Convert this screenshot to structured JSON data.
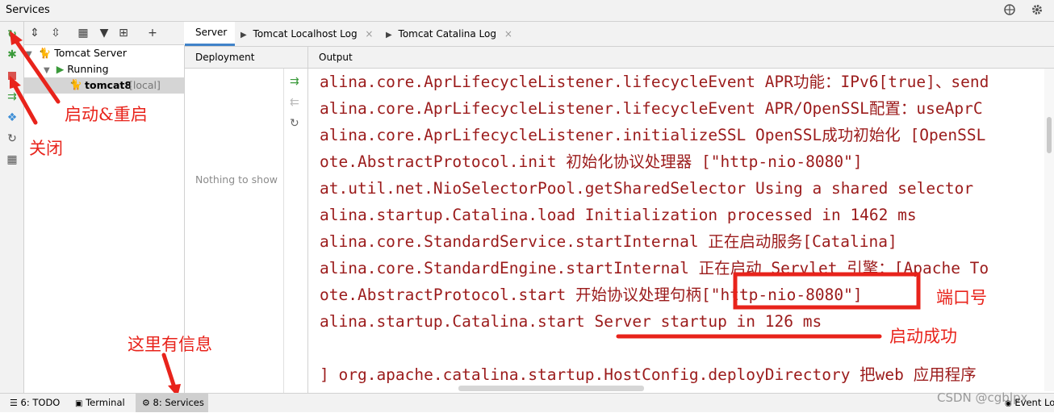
{
  "window": {
    "title": "Services"
  },
  "title_icons": {
    "globe": "globe-icon",
    "gear": "gear-icon"
  },
  "left_toolbar": [
    "rerun-icon",
    "debug-icon",
    "stop-icon",
    "deploy-icon",
    "layout-icon",
    "refresh-icon",
    "grid-icon"
  ],
  "tree_toolbar": [
    "expand-all-icon",
    "collapse-all-icon",
    "group-icon",
    "filter-icon",
    "new-tab-icon",
    "add-icon"
  ],
  "tree": {
    "root": "Tomcat Server",
    "status": "Running",
    "instance": "tomcat8",
    "instance_tag": "[local]"
  },
  "tabs": [
    {
      "label": "Server",
      "active": true
    },
    {
      "label": "Tomcat Localhost Log",
      "active": false
    },
    {
      "label": "Tomcat Catalina Log",
      "active": false
    }
  ],
  "deployment": {
    "header": "Deployment",
    "empty_text": "Nothing to show"
  },
  "output": {
    "header": "Output",
    "lines": [
      "alina.core.AprLifecycleListener.lifecycleEvent APR功能：IPv6[true]、send",
      "alina.core.AprLifecycleListener.lifecycleEvent APR/OpenSSL配置：useAprC",
      "alina.core.AprLifecycleListener.initializeSSL OpenSSL成功初始化 [OpenSSL",
      "ote.AbstractProtocol.init 初始化协议处理器 [\"http-nio-8080\"]",
      "at.util.net.NioSelectorPool.getSharedSelector Using a shared selector",
      "alina.startup.Catalina.load Initialization processed in 1462 ms",
      "alina.core.StandardService.startInternal 正在启动服务[Catalina]",
      "alina.core.StandardEngine.startInternal 正在启动 Servlet 引擎：[Apache To",
      "ote.AbstractProtocol.start 开始协议处理句柄[\"http-nio-8080\"]",
      "alina.startup.Catalina.start Server startup in 126 ms",
      "",
      "] org.apache.catalina.startup.HostConfig.deployDirectory 把web 应用程序"
    ]
  },
  "annotations": {
    "start_restart": "启动&重启",
    "stop": "关闭",
    "info_here": "这里有信息",
    "port": "端口号",
    "started": "启动成功"
  },
  "statusbar": {
    "todo": "6: TODO",
    "terminal": "Terminal",
    "services": "8: Services",
    "event_log": "Event Log",
    "watermark": "CSDN @cgblpx"
  },
  "colors": {
    "annotation": "#e8231b",
    "log_text": "#9b1b1b",
    "run_green": "#3a9a3a"
  }
}
